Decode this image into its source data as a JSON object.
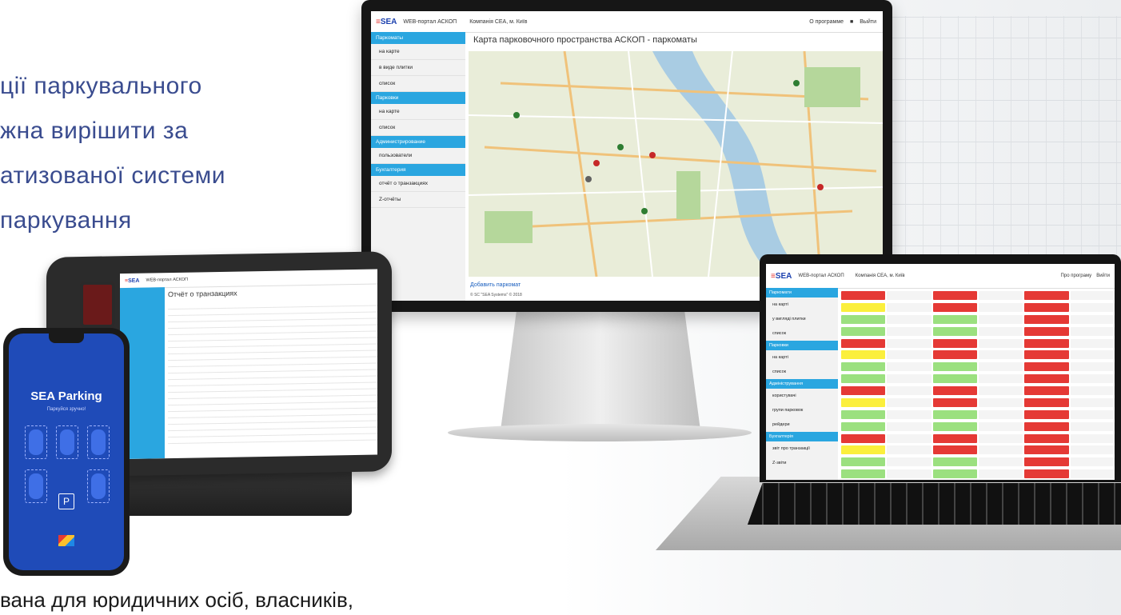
{
  "headline": {
    "lines": [
      "ції паркувального",
      "жна вирішити за",
      "атизованої системи",
      "паркування"
    ]
  },
  "footer": "вана для юридичних осіб, власників,",
  "monitor": {
    "logo": "SEA",
    "app_title": "WEB-портал АСКОП",
    "company": "Компанія СЕА, м. Київ",
    "about": "О программе",
    "logout": "Выйти",
    "page_title": "Карта парковочного пространства АСКОП - паркоматы",
    "sidebar": [
      {
        "section": "Паркоматы",
        "items": [
          "на карте",
          "в виде плитки",
          "список"
        ]
      },
      {
        "section": "Парковки",
        "items": [
          "на карте",
          "список"
        ]
      },
      {
        "section": "Администрирование",
        "items": [
          "пользователи"
        ]
      },
      {
        "section": "Бухгалтерия",
        "items": [
          "отчёт о транзакциях",
          "Z-отчёты"
        ]
      }
    ],
    "add_link": "Добавить паркомат",
    "copyright": "© SC \"SEA Systems\" © 2018"
  },
  "laptop": {
    "logo": "SEA",
    "app_title": "WEB-портал АСКОП",
    "company": "Компанія СЕА, м. Київ",
    "about": "Про програму",
    "logout": "Вийти",
    "sidebar": [
      {
        "section": "Паркомати",
        "items": [
          "на карті",
          "у вигляді плитки",
          "список"
        ]
      },
      {
        "section": "Парковки",
        "items": [
          "на карті",
          "список"
        ]
      },
      {
        "section": "Адміністрування",
        "items": [
          "користувачі",
          "групи парковок",
          "рейдери"
        ]
      },
      {
        "section": "Бухгалтерія",
        "items": [
          "звіт про транзакції",
          "Z-звіти"
        ]
      }
    ],
    "tile_colors": [
      "#e53935",
      "#e53935",
      "#e53935",
      "#fbef3c",
      "#e53935",
      "#e53935",
      "#9be07f",
      "#9be07f",
      "#e53935",
      "#9be07f",
      "#9be07f",
      "#e53935"
    ]
  },
  "tablet": {
    "logo": "SEA",
    "app_title": "WEB-портал АСКОП",
    "page_title": "Отчёт о транзакциях"
  },
  "phone": {
    "title": "SEA Parking",
    "subtitle": "Паркуйся зручно!",
    "parking_badge": "P"
  },
  "colors": {
    "accent": "#2aa6e0",
    "headline": "#3a4c8f",
    "phone_bg": "#1f4bb8"
  }
}
